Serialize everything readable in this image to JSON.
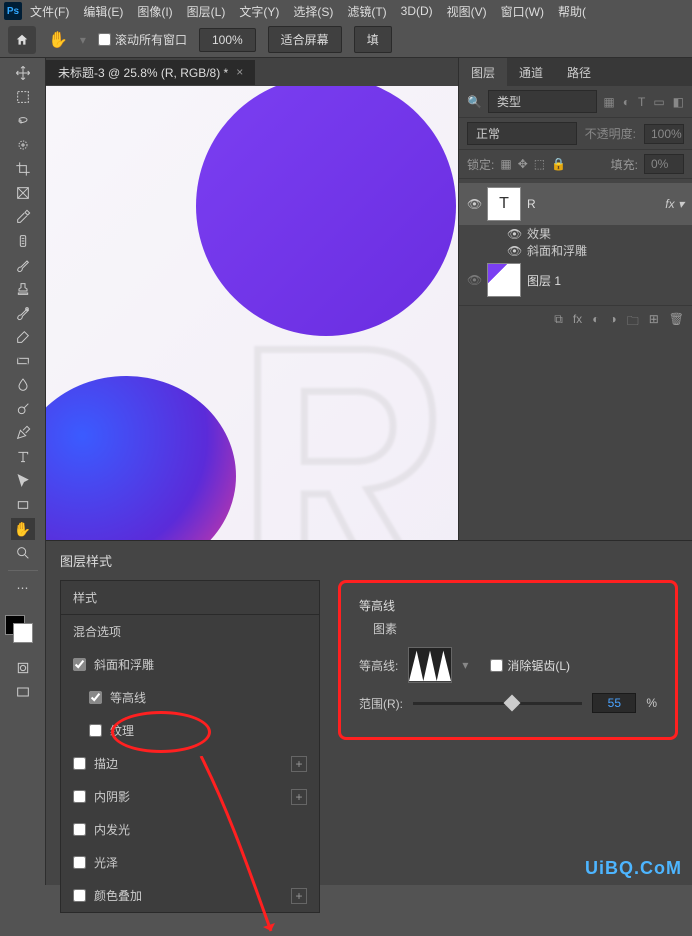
{
  "menubar": {
    "items": [
      "文件(F)",
      "编辑(E)",
      "图像(I)",
      "图层(L)",
      "文字(Y)",
      "选择(S)",
      "滤镜(T)",
      "3D(D)",
      "视图(V)",
      "窗口(W)",
      "帮助("
    ]
  },
  "optbar": {
    "scroll_all": "滚动所有窗口",
    "zoom": "100%",
    "fit": "适合屏幕",
    "fill": "填"
  },
  "doc_tab": {
    "title": "未标题-3 @ 25.8% (R, RGB/8) *"
  },
  "panels": {
    "tabs": [
      "图层",
      "通道",
      "路径"
    ],
    "filter_kind": "类型",
    "blend_mode": "正常",
    "opacity_label": "不透明度:",
    "opacity_value": "100%",
    "lock_label": "锁定:",
    "fill_label": "填充:",
    "fill_value": "0%",
    "layers": [
      {
        "name": "R",
        "thumb": "T",
        "fx": true
      },
      {
        "name": "图层 1",
        "thumb": "img"
      }
    ],
    "fx_label": "效果",
    "fx_items": [
      "斜面和浮雕"
    ]
  },
  "dialog": {
    "title": "图层样式",
    "list_header": "样式",
    "blend_options": "混合选项",
    "items": [
      {
        "label": "斜面和浮雕",
        "checked": true,
        "add": false
      },
      {
        "label": "等高线",
        "checked": true,
        "add": false,
        "highlight": true
      },
      {
        "label": "纹理",
        "checked": false,
        "add": false
      },
      {
        "label": "描边",
        "checked": false,
        "add": true
      },
      {
        "label": "内阴影",
        "checked": false,
        "add": true
      },
      {
        "label": "内发光",
        "checked": false,
        "add": false
      },
      {
        "label": "光泽",
        "checked": false,
        "add": false
      },
      {
        "label": "颜色叠加",
        "checked": false,
        "add": true
      }
    ],
    "section_title": "等高线",
    "section_sub": "图素",
    "contour_label": "等高线:",
    "antialias": "消除锯齿(L)",
    "range_label": "范围(R):",
    "range_value": "55",
    "range_unit": "%"
  },
  "watermark": "UiBQ.CoM"
}
